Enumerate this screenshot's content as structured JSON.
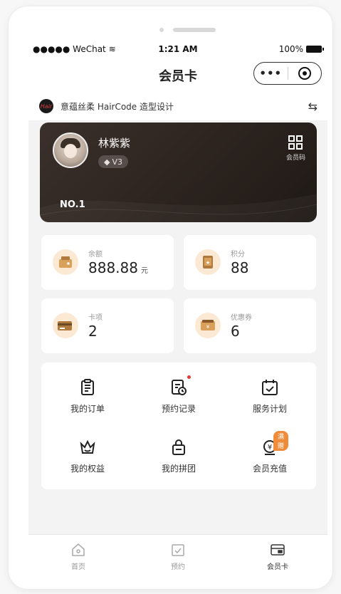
{
  "status_bar": {
    "carrier": "●●●●● WeChat",
    "wifi_icon": "wifi-icon",
    "time": "1:21 AM",
    "battery_percent": "100%"
  },
  "navbar": {
    "title": "会员卡",
    "more_icon": "•••"
  },
  "store": {
    "logo_text": "Hair",
    "name": "意蕴丝柔 HairCode 造型设计",
    "switch_icon": "⇆"
  },
  "member_card": {
    "name": "林紫紫",
    "level": "V3",
    "qr_label": "会员码",
    "card_number": "NO.1",
    "background_color": "#2b231f"
  },
  "stats": [
    {
      "key": "balance",
      "label": "余额",
      "value": "888.88",
      "unit": "元",
      "icon": "wallet-icon"
    },
    {
      "key": "points",
      "label": "积分",
      "value": "88",
      "unit": "",
      "icon": "points-icon"
    },
    {
      "key": "cards",
      "label": "卡项",
      "value": "2",
      "unit": "",
      "icon": "card-icon"
    },
    {
      "key": "coupons",
      "label": "优惠券",
      "value": "6",
      "unit": "",
      "icon": "coupon-icon"
    }
  ],
  "menu": [
    {
      "label": "我的订单",
      "icon": "clipboard-icon"
    },
    {
      "label": "预约记录",
      "icon": "appointment-icon",
      "has_dot": true
    },
    {
      "label": "服务计划",
      "icon": "calendar-icon"
    },
    {
      "label": "我的权益",
      "icon": "crown-icon"
    },
    {
      "label": "我的拼团",
      "icon": "bag-icon"
    },
    {
      "label": "会员充值",
      "icon": "recharge-icon",
      "badge": "满赠"
    }
  ],
  "tabbar": [
    {
      "label": "首页",
      "icon": "home-icon",
      "active": false
    },
    {
      "label": "预约",
      "icon": "booking-icon",
      "active": false
    },
    {
      "label": "会员卡",
      "icon": "member-card-icon",
      "active": true
    }
  ],
  "colors": {
    "accent": "#f08b3a",
    "icon_bg": "#fbe9d3",
    "icon_brown": "#b07a3d",
    "card_dark": "#2b231f"
  }
}
